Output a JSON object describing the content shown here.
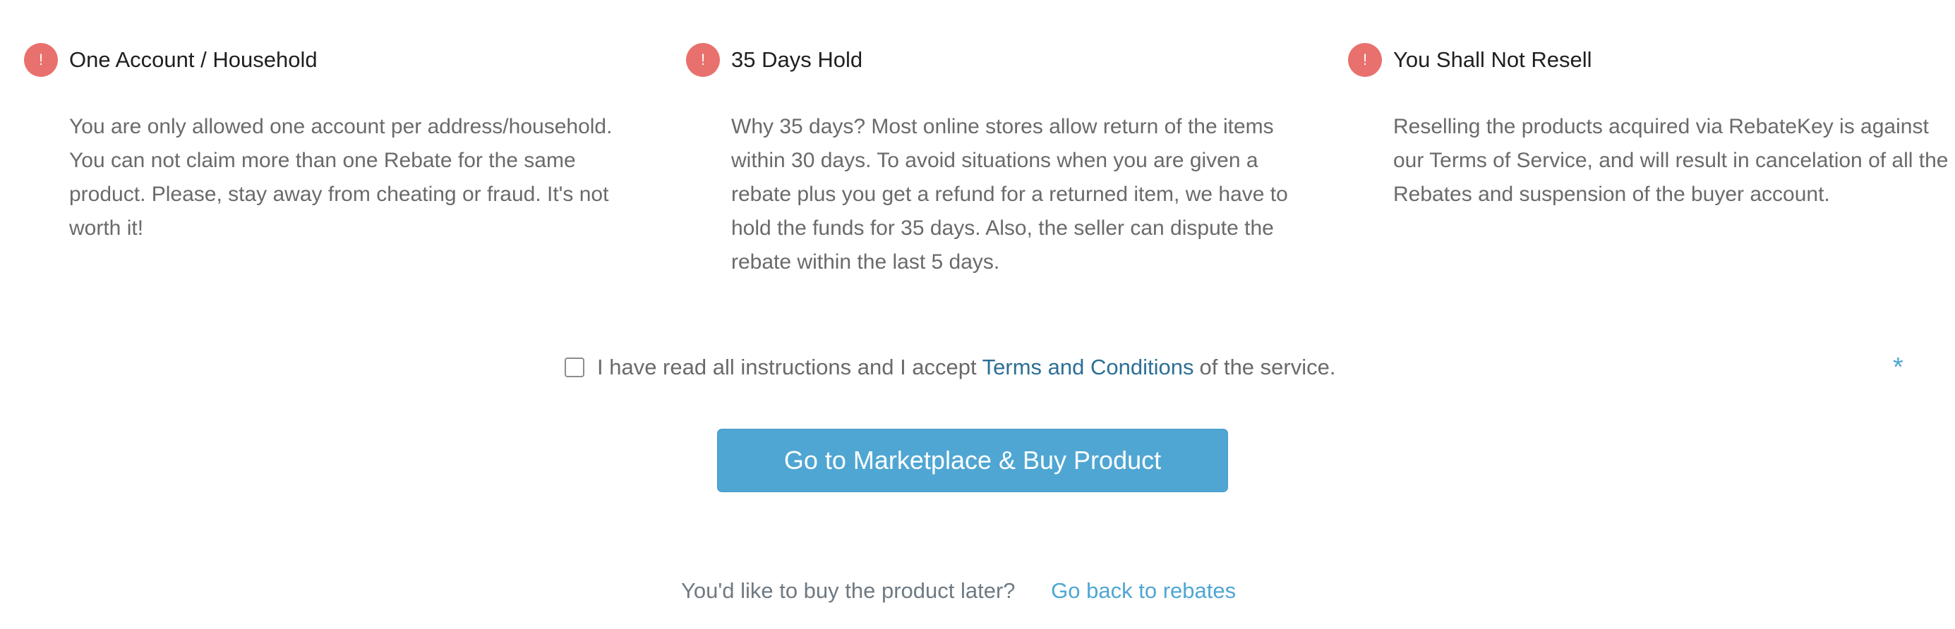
{
  "rules": [
    {
      "icon": "!",
      "title": "One Account / Household",
      "text": "You are only allowed one account per address/household. You can not claim more than one Rebate for the same product. Please, stay away from cheating or fraud. It's not worth it!"
    },
    {
      "icon": "!",
      "title": "35 Days Hold",
      "text": "Why 35 days? Most online stores allow return of the items within 30 days. To avoid situations when you are given a rebate plus you get a refund for a returned item, we have to hold the funds for 35 days. Also, the seller can dispute the rebate within the last 5 days."
    },
    {
      "icon": "!",
      "title": "You Shall Not Resell",
      "text": "Reselling the products acquired via RebateKey is against our Terms of Service, and will result in cancelation of all the Rebates and suspension of the buyer account."
    }
  ],
  "agreement": {
    "prefix": "I have read all instructions and I accept",
    "link": "Terms and Conditions",
    "suffix": "of the service.",
    "required_mark": "*",
    "checked": false
  },
  "primary_button": {
    "label": "Go to Marketplace & Buy Product"
  },
  "later": {
    "question": "You'd like to buy the product later?",
    "link": "Go back to rebates"
  },
  "colors": {
    "alert_icon": "#e8716e",
    "primary": "#4fa6d3",
    "link_dark": "#2c6f95"
  },
  "icons": {
    "rule": "exclamation-circle-icon"
  }
}
